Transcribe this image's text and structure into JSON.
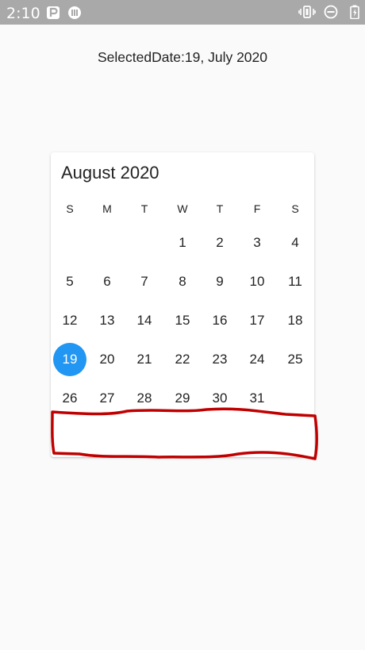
{
  "status_bar": {
    "time": "2:10",
    "left_icons": [
      "parking-icon",
      "media-icon"
    ],
    "right_icons": [
      "vibrate-icon",
      "do-not-disturb-icon",
      "battery-charging-icon"
    ],
    "background": "#a9a9a9"
  },
  "selected_date_label": "SelectedDate:19, July 2020",
  "calendar": {
    "month_title": "August 2020",
    "weekdays": [
      "S",
      "M",
      "T",
      "W",
      "T",
      "F",
      "S"
    ],
    "first_weekday_index": 3,
    "days_in_month": 31,
    "selected_day": 19,
    "accent_color": "#2196f3"
  },
  "annotation": {
    "type": "hand-drawn-rectangle",
    "color": "#c00000"
  }
}
